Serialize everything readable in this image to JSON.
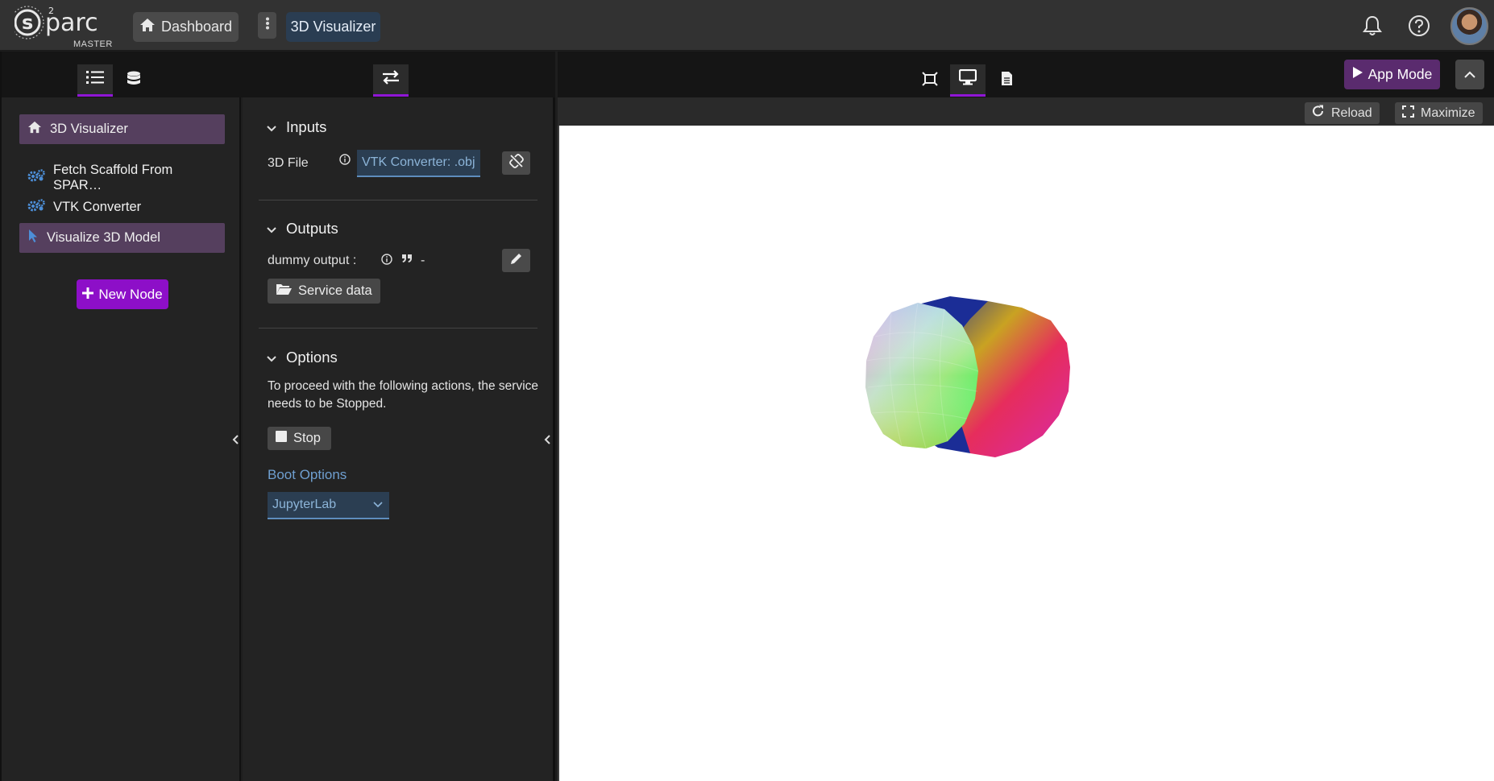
{
  "header": {
    "logo": "s2parc",
    "badge": "MASTER",
    "dashboard_label": "Dashboard",
    "study_name": "3D Visualizer",
    "icons": [
      "bell-icon",
      "help-icon",
      "avatar"
    ]
  },
  "sidebar": {
    "tabs": [
      "list-icon",
      "database-icon"
    ],
    "root_item": "3D Visualizer",
    "items": [
      {
        "label": "Fetch Scaffold From SPAR…",
        "icon": "gears-icon"
      },
      {
        "label": "VTK Converter",
        "icon": "gears-icon"
      },
      {
        "label": "Visualize 3D Model",
        "icon": "pointer-icon"
      }
    ],
    "new_node_label": "New Node"
  },
  "node_panel": {
    "inputs_title": "Inputs",
    "input_label": "3D File",
    "input_value": "VTK Converter: .obj",
    "outputs_title": "Outputs",
    "output_label": "dummy output :",
    "output_value": "-",
    "service_data_label": "Service data",
    "options_title": "Options",
    "options_text": "To proceed with the following actions, the service needs to be Stopped.",
    "stop_label": "Stop",
    "boot_options_label": "Boot Options",
    "boot_option_selected": "JupyterLab"
  },
  "viewer": {
    "tabs": [
      "fit-icon",
      "monitor-icon",
      "file-icon"
    ],
    "app_mode_label": "App Mode",
    "reload_label": "Reload",
    "maximize_label": "Maximize"
  },
  "colors": {
    "accent": "#8d0fc8",
    "selected": "#553f5e",
    "link_bg": "#2b3e52",
    "link_text": "#8cb4d8"
  }
}
